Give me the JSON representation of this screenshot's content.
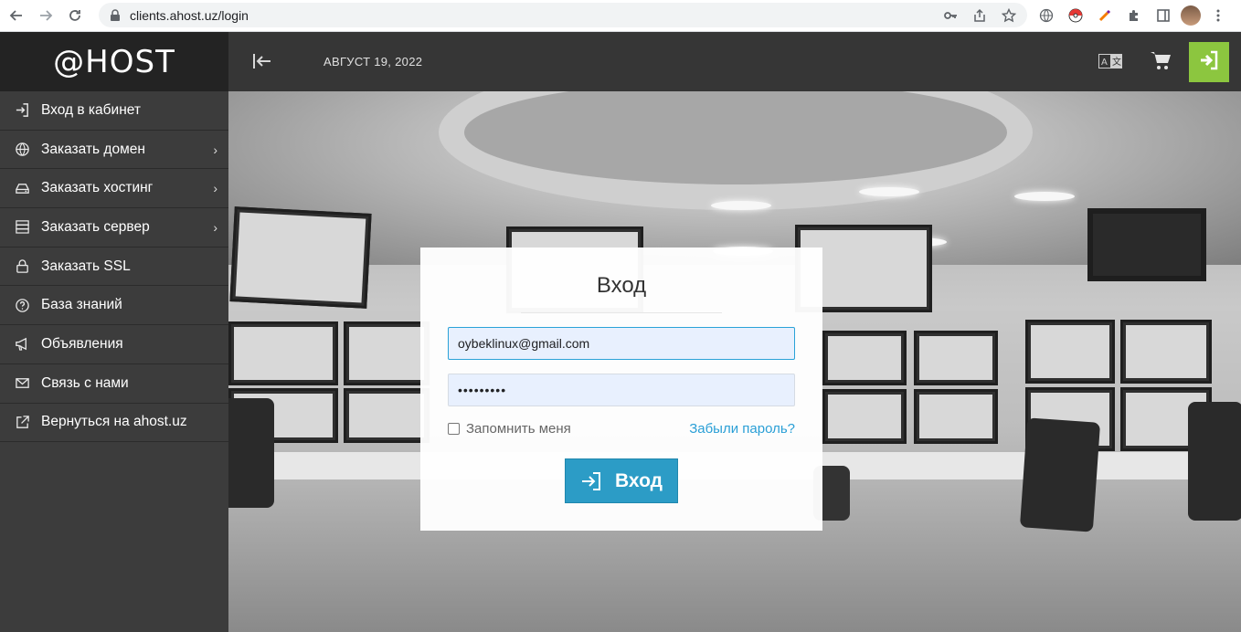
{
  "browser": {
    "url": "clients.ahost.uz/login"
  },
  "sidebar": {
    "logo": "@HOST",
    "items": [
      {
        "label": "Вход в кабинет",
        "icon": "login-icon",
        "has_submenu": false
      },
      {
        "label": "Заказать домен",
        "icon": "globe-icon",
        "has_submenu": true
      },
      {
        "label": "Заказать хостинг",
        "icon": "hdd-icon",
        "has_submenu": true
      },
      {
        "label": "Заказать сервер",
        "icon": "server-icon",
        "has_submenu": true
      },
      {
        "label": "Заказать SSL",
        "icon": "lock-icon",
        "has_submenu": false
      },
      {
        "label": "База знаний",
        "icon": "question-icon",
        "has_submenu": false
      },
      {
        "label": "Объявления",
        "icon": "megaphone-icon",
        "has_submenu": false
      },
      {
        "label": "Связь с нами",
        "icon": "envelope-icon",
        "has_submenu": false
      },
      {
        "label": "Вернуться на ahost.uz",
        "icon": "external-link-icon",
        "has_submenu": false
      }
    ]
  },
  "header": {
    "date": "АВГУСТ 19, 2022"
  },
  "login": {
    "title": "Вход",
    "email_value": "oybeklinux@gmail.com",
    "password_value": "•••••••••",
    "remember_label": "Запомнить меня",
    "forgot_label": "Забыли пароль?",
    "submit_label": "Вход"
  },
  "colors": {
    "accent_green": "#8cc63f",
    "button_blue": "#2c9cc6",
    "link_blue": "#2a9fd6",
    "sidebar_bg": "#3c3c3c"
  }
}
